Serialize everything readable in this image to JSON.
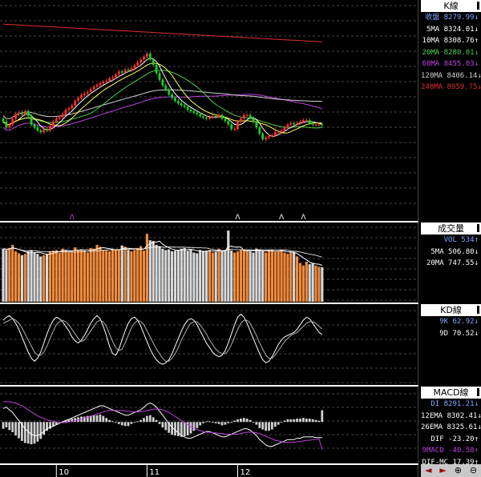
{
  "panels": {
    "k": {
      "title": "K線",
      "rows": [
        {
          "label": "收盤",
          "value": "8279.99",
          "arrow": "↓",
          "color": "#7fa8ff"
        },
        {
          "label": "5MA",
          "value": "8324.01",
          "arrow": "↓",
          "color": "#ffffff"
        },
        {
          "label": "10MA",
          "value": "8308.76",
          "arrow": "↑",
          "color": "#ffffff"
        },
        {
          "label": "20MA",
          "value": "8280.01",
          "arrow": "↓",
          "color": "#4cd04c"
        },
        {
          "label": "60MA",
          "value": "8455.03",
          "arrow": "↓",
          "color": "#c040e0"
        },
        {
          "label": "120MA",
          "value": "8406.14",
          "arrow": "↓",
          "color": "#d0d0d0"
        },
        {
          "label": "240MA",
          "value": "8959.75",
          "arrow": "↓",
          "color": "#e03030"
        }
      ]
    },
    "vol": {
      "title": "成交量",
      "rows": [
        {
          "label": "VOL",
          "value": "534",
          "arrow": "↑",
          "color": "#7fa8ff"
        },
        {
          "label": "5MA",
          "value": "506.80",
          "arrow": "↓",
          "color": "#ffffff"
        },
        {
          "label": "20MA",
          "value": "747.55",
          "arrow": "↓",
          "color": "#ffffff"
        }
      ]
    },
    "kd": {
      "title": "KD線",
      "rows": [
        {
          "label": "9K",
          "value": "62.92",
          "arrow": "↓",
          "color": "#7fa8ff"
        },
        {
          "label": "9D",
          "value": "70.52",
          "arrow": "↓",
          "color": "#ffffff"
        }
      ]
    },
    "macd": {
      "title": "MACD線",
      "rows": [
        {
          "label": "DI",
          "value": "8291.21",
          "arrow": "↓",
          "color": "#7fa8ff"
        },
        {
          "label": "12EMA",
          "value": "8302.41",
          "arrow": "↓",
          "color": "#ffffff"
        },
        {
          "label": "26EMA",
          "value": "8325.61",
          "arrow": "↓",
          "color": "#ffffff"
        },
        {
          "label": "DIF",
          "value": "-23.20",
          "arrow": "↑",
          "color": "#ffffff"
        },
        {
          "label": "9MACD",
          "value": "-40.58",
          "arrow": "↑",
          "color": "#c040e0"
        },
        {
          "label": "DIF-MC",
          "value": "17.39",
          "arrow": "↑",
          "color": "#ffffff"
        }
      ]
    }
  },
  "nav": {
    "left": "◄",
    "right": "►",
    "zoom_in": "⊕",
    "zoom_out": "⊖"
  },
  "chart_data": {
    "type": "candlestick",
    "x_month_labels": [
      {
        "label": "10",
        "index": 17
      },
      {
        "label": "11",
        "index": 46
      },
      {
        "label": "12",
        "index": 75
      }
    ],
    "price": {
      "open": [
        8380,
        8370,
        8350,
        8360,
        8380,
        8395,
        8400,
        8395,
        8405,
        8390,
        8360,
        8350,
        8340,
        8335,
        8345,
        8340,
        8355,
        8370,
        8380,
        8385,
        8395,
        8410,
        8415,
        8425,
        8440,
        8450,
        8460,
        8465,
        8470,
        8480,
        8488,
        8494,
        8500,
        8505,
        8508,
        8516,
        8520,
        8530,
        8540,
        8536,
        8546,
        8544,
        8550,
        8560,
        8570,
        8580,
        8590,
        8600,
        8580,
        8562,
        8534,
        8512,
        8492,
        8478,
        8462,
        8450,
        8440,
        8432,
        8425,
        8420,
        8410,
        8405,
        8400,
        8395,
        8388,
        8384,
        8380,
        8385,
        8388,
        8386,
        8392,
        8380,
        8372,
        8360,
        8345,
        8345,
        8370,
        8380,
        8392,
        8392,
        8382,
        8369,
        8350,
        8329,
        8310,
        8316,
        8320,
        8324,
        8335,
        8335,
        8340,
        8350,
        8360,
        8365,
        8362,
        8365,
        8370,
        8375,
        8375,
        8365,
        8360,
        8360,
        8360
      ],
      "close": [
        8370,
        8350,
        8360,
        8380,
        8395,
        8400,
        8395,
        8405,
        8390,
        8360,
        8350,
        8340,
        8335,
        8345,
        8340,
        8355,
        8370,
        8380,
        8385,
        8395,
        8410,
        8415,
        8425,
        8440,
        8450,
        8460,
        8465,
        8470,
        8480,
        8488,
        8494,
        8500,
        8505,
        8508,
        8516,
        8520,
        8530,
        8540,
        8536,
        8546,
        8544,
        8550,
        8560,
        8570,
        8580,
        8590,
        8600,
        8580,
        8562,
        8534,
        8512,
        8492,
        8478,
        8462,
        8450,
        8440,
        8432,
        8425,
        8420,
        8410,
        8405,
        8400,
        8395,
        8388,
        8384,
        8380,
        8385,
        8388,
        8386,
        8392,
        8380,
        8372,
        8360,
        8345,
        8345,
        8370,
        8380,
        8392,
        8392,
        8382,
        8369,
        8350,
        8329,
        8310,
        8316,
        8320,
        8324,
        8335,
        8335,
        8340,
        8350,
        8360,
        8365,
        8362,
        8365,
        8370,
        8375,
        8375,
        8365,
        8360,
        8360,
        8360,
        8358
      ],
      "ma_series": [
        {
          "name": "240MA",
          "color": "#e03030",
          "start": 8700,
          "end": 8640
        },
        {
          "name": "60MA",
          "color": "#c040e0"
        },
        {
          "name": "120MA",
          "color": "#d0d0d0"
        },
        {
          "name": "20MA",
          "color": "#4cd04c"
        },
        {
          "name": "5MA",
          "color": "#ffffff"
        },
        {
          "name": "10MA",
          "color": "#ffff60"
        }
      ],
      "ylim": [
        8050,
        8760
      ],
      "signal_marks_index": [
        22,
        75,
        89,
        96
      ]
    },
    "volume": {
      "values": [
        820,
        800,
        830,
        880,
        780,
        750,
        720,
        740,
        780,
        800,
        760,
        740,
        700,
        720,
        740,
        780,
        790,
        800,
        760,
        820,
        800,
        780,
        770,
        840,
        800,
        810,
        790,
        760,
        830,
        820,
        880,
        850,
        800,
        790,
        780,
        820,
        810,
        800,
        870,
        850,
        800,
        780,
        800,
        830,
        860,
        790,
        1050,
        950,
        940,
        880,
        860,
        820,
        800,
        810,
        780,
        790,
        800,
        820,
        830,
        790,
        810,
        760,
        750,
        800,
        780,
        790,
        800,
        760,
        770,
        820,
        780,
        800,
        1100,
        790,
        760,
        780,
        800,
        810,
        790,
        780,
        760,
        820,
        800,
        780,
        760,
        790,
        800,
        770,
        780,
        800,
        760,
        740,
        770,
        760,
        700,
        600,
        560,
        620,
        580,
        600,
        560,
        540,
        534
      ],
      "ylim": [
        0,
        1200
      ]
    },
    "kd": {
      "k": [
        82,
        86,
        88,
        84,
        78,
        70,
        60,
        50,
        40,
        32,
        28,
        32,
        40,
        52,
        64,
        74,
        82,
        86,
        84,
        80,
        74,
        68,
        60,
        55,
        52,
        56,
        62,
        70,
        78,
        84,
        88,
        84,
        74,
        62,
        48,
        38,
        36,
        44,
        56,
        68,
        78,
        84,
        86,
        82,
        74,
        64,
        54,
        44,
        36,
        30,
        26,
        24,
        26,
        30,
        38,
        48,
        58,
        68,
        76,
        82,
        84,
        82,
        76,
        68,
        60,
        52,
        46,
        40,
        36,
        34,
        36,
        42,
        52,
        64,
        76,
        86,
        90,
        86,
        78,
        68,
        58,
        48,
        38,
        30,
        26,
        28,
        34,
        42,
        50,
        56,
        60,
        62,
        64,
        66,
        70,
        76,
        82,
        86,
        84,
        78,
        72,
        66,
        62.92
      ],
      "d": [
        78,
        80,
        82,
        84,
        82,
        78,
        72,
        64,
        56,
        48,
        40,
        36,
        36,
        40,
        48,
        58,
        68,
        76,
        80,
        82,
        80,
        76,
        70,
        64,
        58,
        54,
        56,
        62,
        68,
        74,
        80,
        82,
        80,
        74,
        64,
        54,
        46,
        42,
        44,
        52,
        62,
        72,
        78,
        82,
        80,
        76,
        68,
        60,
        52,
        44,
        38,
        32,
        28,
        28,
        32,
        38,
        46,
        56,
        64,
        72,
        78,
        80,
        80,
        76,
        70,
        64,
        56,
        50,
        44,
        40,
        38,
        38,
        42,
        50,
        60,
        70,
        78,
        82,
        82,
        78,
        70,
        62,
        52,
        44,
        36,
        32,
        32,
        36,
        42,
        48,
        54,
        58,
        62,
        64,
        66,
        70,
        74,
        78,
        80,
        80,
        78,
        74,
        70.52
      ],
      "ylim": [
        0,
        100
      ]
    },
    "macd": {
      "dif": [
        20,
        22,
        18,
        14,
        8,
        2,
        -4,
        -10,
        -14,
        -18,
        -20,
        -20,
        -18,
        -14,
        -10,
        -8,
        -6,
        -4,
        -2,
        0,
        2,
        4,
        6,
        8,
        10,
        12,
        14,
        16,
        18,
        20,
        22,
        24,
        24,
        22,
        20,
        18,
        16,
        14,
        12,
        10,
        10,
        12,
        14,
        16,
        18,
        22,
        26,
        28,
        26,
        22,
        16,
        10,
        4,
        -2,
        -8,
        -12,
        -16,
        -20,
        -22,
        -24,
        -24,
        -22,
        -20,
        -18,
        -16,
        -14,
        -14,
        -16,
        -18,
        -20,
        -22,
        -22,
        -20,
        -18,
        -16,
        -14,
        -12,
        -10,
        -10,
        -12,
        -16,
        -20,
        -26,
        -30,
        -34,
        -36,
        -36,
        -34,
        -32,
        -30,
        -28,
        -26,
        -26,
        -26,
        -24,
        -24,
        -22,
        -22,
        -22,
        -22,
        -23,
        -23,
        -23.2
      ],
      "macd": [
        30,
        30,
        30,
        29,
        28,
        26,
        24,
        21,
        18,
        15,
        12,
        9,
        7,
        5,
        3,
        2,
        1,
        0,
        -1,
        -1,
        -1,
        0,
        1,
        2,
        3,
        4,
        6,
        7,
        9,
        10,
        12,
        13,
        15,
        16,
        17,
        17,
        17,
        17,
        17,
        16,
        16,
        15,
        15,
        15,
        15,
        16,
        17,
        18,
        19,
        19,
        19,
        18,
        16,
        14,
        11,
        8,
        5,
        2,
        -1,
        -4,
        -7,
        -9,
        -11,
        -13,
        -14,
        -15,
        -15,
        -16,
        -16,
        -17,
        -17,
        -18,
        -18,
        -18,
        -18,
        -18,
        -17,
        -16,
        -15,
        -15,
        -15,
        -16,
        -17,
        -19,
        -21,
        -23,
        -25,
        -27,
        -28,
        -29,
        -30,
        -30,
        -30,
        -30,
        -29,
        -29,
        -28,
        -27,
        -27,
        -26,
        -26,
        -25,
        -40.58
      ],
      "ylim": [
        -60,
        50
      ]
    }
  }
}
